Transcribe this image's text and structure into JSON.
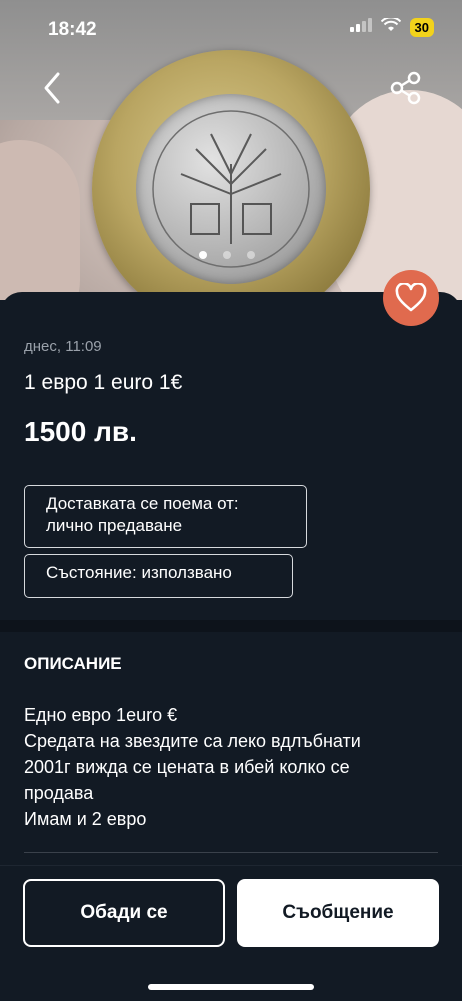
{
  "status_bar": {
    "time": "18:42",
    "battery": "30"
  },
  "gallery": {
    "dots": 3,
    "active_dot": 0
  },
  "listing": {
    "date": "днес, 11:09",
    "title": "1 евро 1 euro 1€",
    "price": "1500 лв.",
    "tags": {
      "delivery": "Доставката се поема от: лично предаване",
      "condition": "Състояние: използвано"
    }
  },
  "description": {
    "heading": "ОПИСАНИЕ",
    "lines": [
      "Едно евро 1euro €",
      "Средата на звездите са леко вдлъбнати",
      "2001г вижда се цената в ибей колко се",
      "продава",
      "Имам и 2 евро"
    ]
  },
  "actions": {
    "call": "Обади се",
    "message": "Съобщение"
  },
  "colors": {
    "background": "#121a24",
    "heart": "#e06a4e",
    "battery": "#f2d21b"
  }
}
